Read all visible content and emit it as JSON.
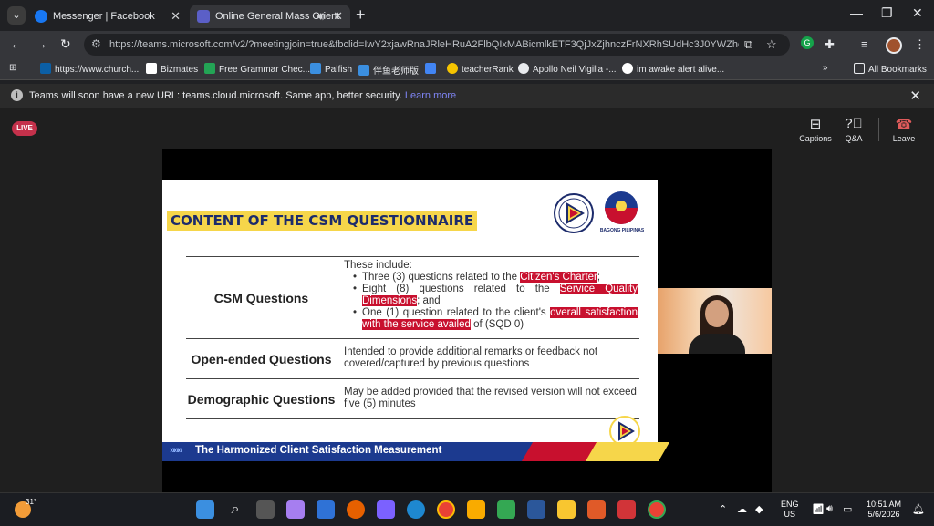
{
  "browser": {
    "tabs": [
      {
        "title": "Messenger | Facebook",
        "active": false
      },
      {
        "title": "Online General Mass Orient",
        "active": true
      }
    ],
    "address": "https://teams.microsoft.com/v2/?meetingjoin=true&fbclid=IwY2xjawRnaJRleHRuA2FlbQIxMABicmlkETF3QjJxZjhnczFrNXRhSUdHc3J0YWZhcHBfaW...",
    "bookmarks": [
      "https://www.church...",
      "Bizmates",
      "Free Grammar Chec...",
      "Palfish",
      "伴鱼老师版",
      "teacherRank",
      "Apollo Neil Vigilla -...",
      "im awake alert alive...",
      "All Bookmarks"
    ]
  },
  "infobar": {
    "message": "Teams will soon have a new URL: teams.cloud.microsoft. Same app, better security.",
    "link": "Learn more"
  },
  "teams": {
    "live_badge": "LIVE",
    "controls": [
      {
        "label": "Captions",
        "icon": "captions-icon"
      },
      {
        "label": "Q&A",
        "icon": "qa-icon"
      },
      {
        "label": "Leave",
        "icon": "phone-hangup-icon"
      }
    ]
  },
  "slide": {
    "title": "CONTENT OF THE CSM QUESTIONNAIRE",
    "logo_text": "BAGONG PILIPINAS",
    "arta_text": "ARTA",
    "rows": [
      {
        "category": "CSM Questions",
        "intro": "These include:",
        "bullets": [
          {
            "before": "Three (3) questions related to the ",
            "highlight": "Citizen's Charter",
            "after": ";"
          },
          {
            "before": "Eight (8) questions related to the ",
            "highlight": "Service Quality Dimensions",
            "after": "; and"
          },
          {
            "before": "One (1) question related to the client's ",
            "highlight": "overall satisfaction with the service availed",
            "after": " of (SQD 0)"
          }
        ]
      },
      {
        "category": "Open-ended Questions",
        "description": "Intended to provide additional remarks or feedback not covered/captured by previous questions"
      },
      {
        "category": "Demographic Questions",
        "description": "May be added provided that the revised version will not exceed five (5) minutes"
      }
    ],
    "footer": "The Harmonized Client Satisfaction Measurement",
    "footer_chevrons": "»»»"
  },
  "taskbar": {
    "weather": "31°",
    "language": "ENG",
    "region": "US",
    "time": "10:51 AM",
    "date": "5/6/2026"
  }
}
